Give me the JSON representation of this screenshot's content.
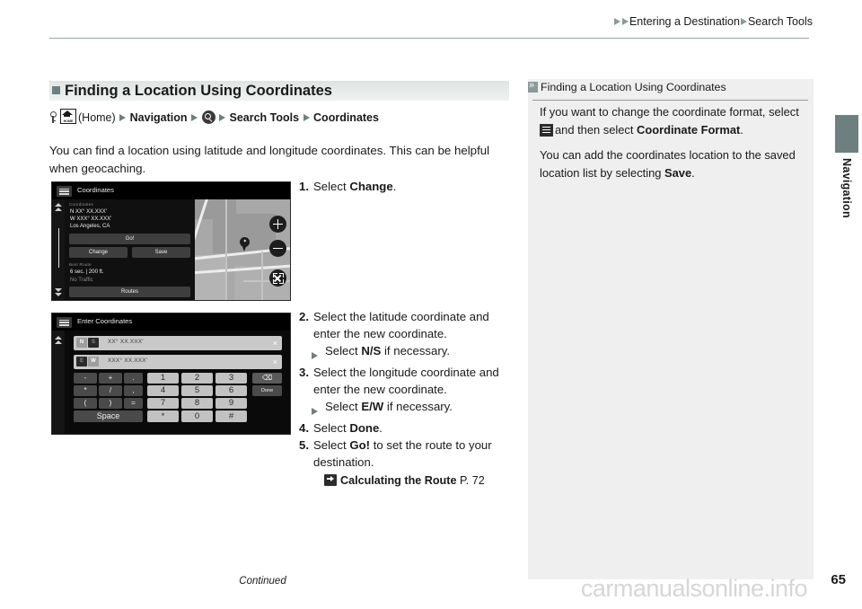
{
  "header": {
    "breadcrumb": [
      "Entering a Destination",
      "Search Tools"
    ]
  },
  "side_tab": {
    "label": "Navigation"
  },
  "section": {
    "title": "Finding a Location Using Coordinates",
    "nav_path": {
      "key_icon": "key-icon",
      "home_icon": "home-icon",
      "home_word": "HOME",
      "home_label": "(Home)",
      "item1": "Navigation",
      "search_icon": "magnifier-icon",
      "item2": "Search Tools",
      "item3": "Coordinates"
    },
    "intro": "You can find a location using latitude and longitude coordinates. This can be helpful when geocaching."
  },
  "steps_group1": [
    {
      "num": "1.",
      "pre": "Select ",
      "strong": "Change",
      "post": "."
    }
  ],
  "steps_group2": [
    {
      "num": "2.",
      "pre": "Select the latitude coordinate and enter the new coordinate.",
      "strong": "",
      "post": "",
      "sub": {
        "pre": "Select ",
        "strong": "N/S",
        "post": " if necessary."
      }
    },
    {
      "num": "3.",
      "pre": "Select the longitude coordinate and enter the new coordinate.",
      "strong": "",
      "post": "",
      "sub": {
        "pre": "Select ",
        "strong": "E/W",
        "post": " if necessary."
      }
    },
    {
      "num": "4.",
      "pre": "Select ",
      "strong": "Done",
      "post": "."
    },
    {
      "num": "5.",
      "pre": "Select ",
      "strong": "Go!",
      "post": " to set the route to your destination."
    }
  ],
  "reference": {
    "title": "Calculating the Route",
    "page": "P. 72"
  },
  "note": {
    "heading": "Finding a Location Using Coordinates",
    "p1_part1": "If you want to change the coordinate format, select",
    "p1_part2": "and then select ",
    "p1_strong": "Coordinate Format",
    "p1_part3": ".",
    "p2_part1": "You can add the coordinates location to the saved location list by selecting ",
    "p2_strong": "Save",
    "p2_part2": "."
  },
  "screenshot_coordinates": {
    "title": "Coordinates",
    "section_label": "Coordinates",
    "lat": "N XX° XX.XXX'",
    "lon": "W XXX° XX.XXX'",
    "city": "Los Angeles, CA",
    "go_button": "Go!",
    "change_button": "Change",
    "save_button": "Save",
    "best_route_label": "Best Route",
    "eta": "6 sec. | 200 ft.",
    "traffic": "No Traffic",
    "routes_button": "Routes",
    "zoom_in": "+",
    "zoom_out": "−",
    "expand": "expand-icon"
  },
  "screenshot_keyboard": {
    "title": "Enter Coordinates",
    "lat_field": {
      "toggle_on": "N",
      "toggle_off": "S",
      "value": "XX°    XX.XXX'",
      "clear": "×"
    },
    "lon_field": {
      "toggle_on": "W",
      "toggle_off": "E",
      "value": "XXX°   XX.XXX'",
      "clear": "×"
    },
    "symbol_keys": [
      "-",
      "+",
      ".",
      "*",
      "/",
      ",",
      "(",
      ")",
      "="
    ],
    "space_key": "Space",
    "number_keys": [
      "1",
      "2",
      "3",
      "4",
      "5",
      "6",
      "7",
      "8",
      "9",
      "*",
      "0",
      "#"
    ],
    "backspace_key": "⌫",
    "done_key": "Done"
  },
  "footer": {
    "continued": "Continued",
    "page_number": "65",
    "watermark": "carmanualsonline.info"
  }
}
